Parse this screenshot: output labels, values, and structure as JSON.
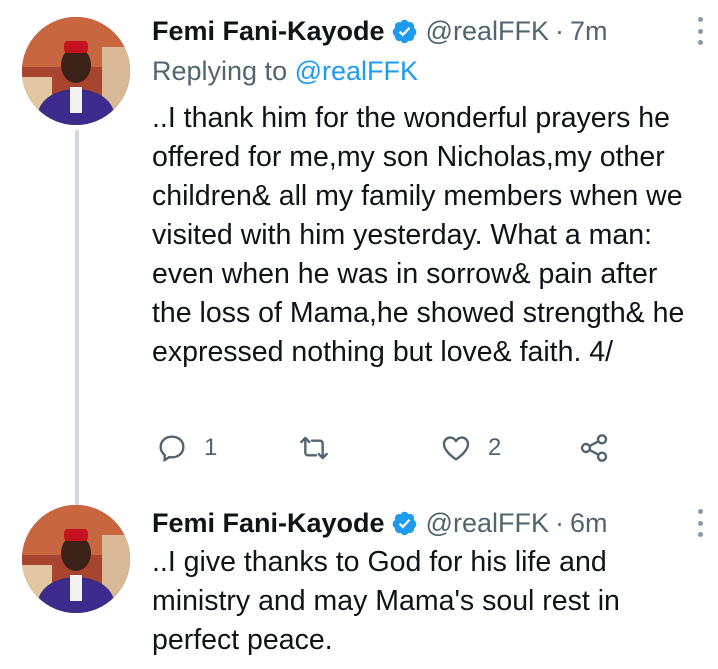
{
  "tweets": [
    {
      "author_name": "Femi Fani-Kayode",
      "handle": "@realFFK",
      "separator": "·",
      "time": "7m",
      "replying_prefix": "Replying to ",
      "replying_to": "@realFFK",
      "text": "..I thank him for the wonderful prayers he offered for me,my son Nicholas,my other children& all my family members when we visited with him yesterday. What a man: even when he was in sorrow& pain after the loss of Mama,he showed strength& he expressed nothing but love& faith. 4/",
      "reply_count": "1",
      "retweet_count": "",
      "like_count": "2"
    },
    {
      "author_name": "Femi Fani-Kayode",
      "handle": "@realFFK",
      "separator": "·",
      "time": "6m",
      "text": "..I give thanks to God for his life and ministry and may Mama's soul rest in perfect peace."
    }
  ],
  "icons": {
    "verified": "verified-badge-icon",
    "more": "more-vertical-icon",
    "reply": "reply-icon",
    "retweet": "retweet-icon",
    "like": "heart-icon",
    "share": "share-icon"
  },
  "colors": {
    "verified": "#1d9bf0",
    "mention": "#1d9bf0",
    "muted": "#536471",
    "thread_line": "#cfd9de"
  }
}
